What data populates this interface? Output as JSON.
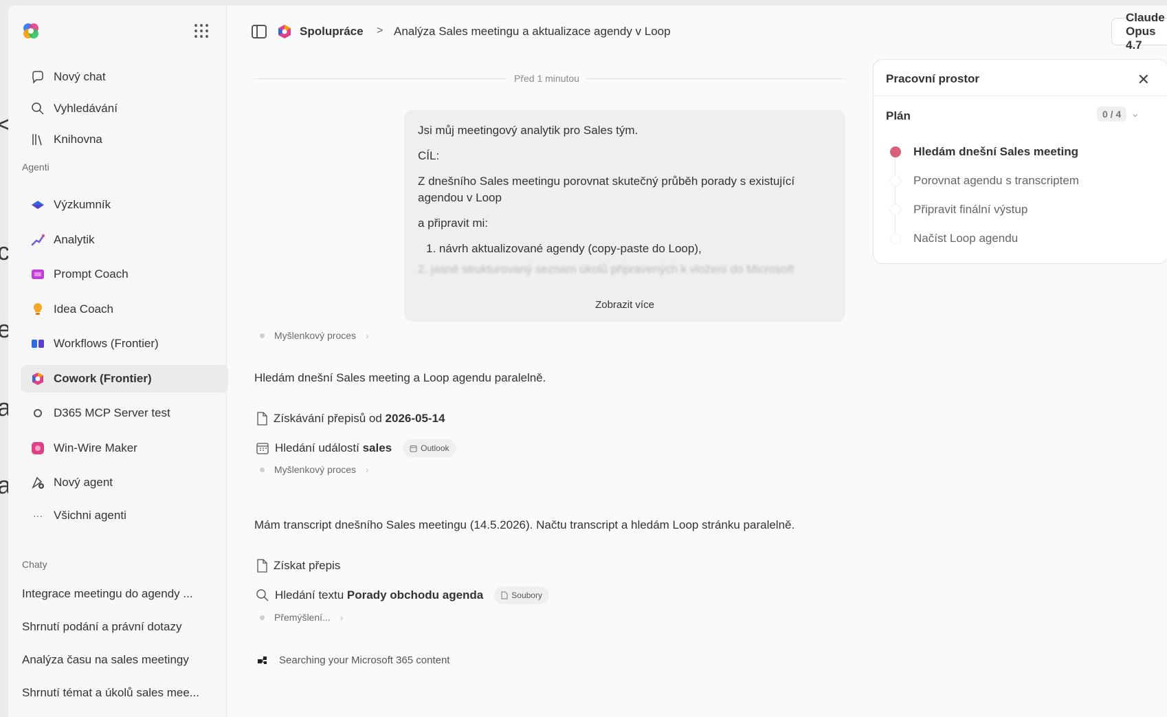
{
  "colors": {
    "accent_pink": "#d9607a",
    "sidebar_bg": "#f7f7f7",
    "active_bg": "#ebebeb"
  },
  "behind": [
    "<",
    "c",
    "e",
    "a",
    "a"
  ],
  "sidebar": {
    "top_nav": [
      {
        "label": "Nový chat",
        "icon": "chat-icon"
      },
      {
        "label": "Vyhledávání",
        "icon": "search-icon"
      },
      {
        "label": "Knihovna",
        "icon": "library-icon"
      }
    ],
    "agents_label": "Agenti",
    "agents": [
      {
        "label": "Výzkumník",
        "icon": "researcher-icon"
      },
      {
        "label": "Analytik",
        "icon": "analyst-icon"
      },
      {
        "label": "Prompt Coach",
        "icon": "prompt-coach-icon"
      },
      {
        "label": "Idea Coach",
        "icon": "idea-coach-icon"
      },
      {
        "label": "Workflows (Frontier)",
        "icon": "workflows-icon"
      },
      {
        "label": "Cowork (Frontier)",
        "icon": "cowork-icon",
        "active": true
      },
      {
        "label": "D365 MCP Server test",
        "icon": "server-icon"
      },
      {
        "label": "Win-Wire Maker",
        "icon": "winwire-icon"
      },
      {
        "label": "Nový agent",
        "icon": "new-agent-icon"
      },
      {
        "label": "Všichni agenti",
        "icon": "more-icon"
      }
    ],
    "chats_label": "Chaty",
    "chats": [
      "Integrace meetingu do agendy ...",
      "Shrnutí podání a právní dotazy",
      "Analýza času na sales meetingy",
      "Shrnutí témat a úkolů sales mee..."
    ]
  },
  "topbar": {
    "breadcrumb_root": "Spolupráce",
    "breadcrumb_sep": ">",
    "breadcrumb_current": "Analýza Sales meetingu a aktualizace agendy v Loop",
    "model": "Claude Opus 4.7",
    "more": "···"
  },
  "main": {
    "timestamp": "Před 1 minutou",
    "user_message": {
      "lines": [
        "Jsi můj meetingový analytik pro Sales tým.",
        "CÍL:",
        "Z dnešního Sales meetingu porovnat skutečný průběh porady s existující agendou v Loop",
        "a připravit mi:",
        "1. návrh aktualizované agendy (copy-paste do Loop),"
      ],
      "faded": "2. jasně strukturovaný seznam úkolů připravených k vložení do Microsoft",
      "show_more": "Zobrazit více"
    },
    "thought_1": "Myšlenkový proces",
    "para_1": "Hledám dnešní Sales meeting a Loop agendu paralelně.",
    "tool_1": {
      "text": "Získávání přepisů od ",
      "bold": "2026-05-14"
    },
    "tool_2": {
      "text": "Hledání událostí ",
      "bold": "sales",
      "chip": "Outlook"
    },
    "thought_2": "Myšlenkový proces",
    "para_2": "Mám transcript dnešního Sales meetingu (14.5.2026). Načtu transcript a hledám Loop stránku paralelně.",
    "tool_3": {
      "text": "Získat přepis"
    },
    "tool_4": {
      "text": "Hledání textu ",
      "bold": "Porady obchodu agenda",
      "chip": "Soubory"
    },
    "thought_3": "Přemýšlení...",
    "status": "Searching your Microsoft 365 content"
  },
  "workspace": {
    "title": "Pracovní prostor",
    "plan_title": "Plán",
    "plan_count": "0 / 4",
    "steps": [
      {
        "label": "Hledám dnešní Sales meeting",
        "current": true
      },
      {
        "label": "Porovnat agendu s transcriptem"
      },
      {
        "label": "Připravit finální výstup"
      },
      {
        "label": "Načíst Loop agendu"
      }
    ]
  }
}
